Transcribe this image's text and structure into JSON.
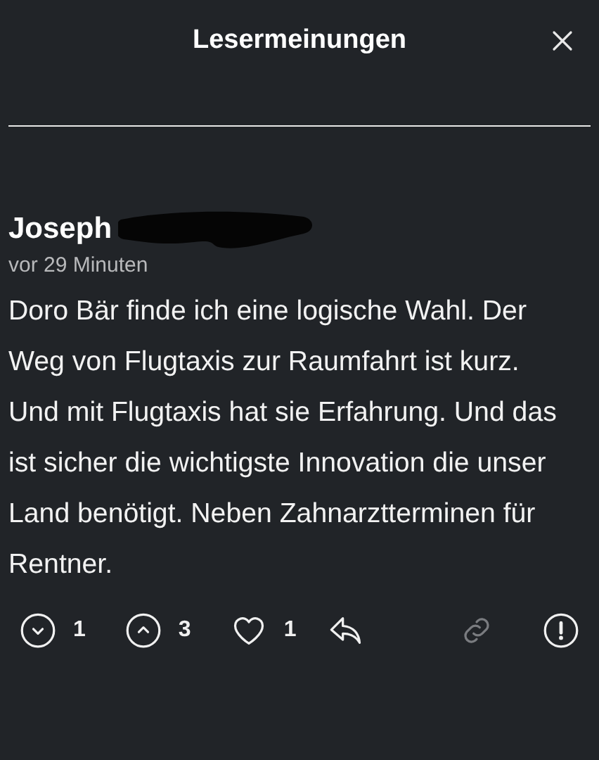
{
  "header": {
    "title": "Lesermeinungen"
  },
  "comment": {
    "author": "Joseph",
    "author_redacted": true,
    "time": "vor 29 Minuten",
    "text": "Doro Bär finde ich eine logische Wahl. Der Weg von Flugtaxis zur Raumfahrt ist kurz. Und mit Flugtaxis hat sie Erfahrung. Und das ist sicher die wichtigste Innovation die unser Land benötigt. Neben Zahnarztterminen für Rentner."
  },
  "actions": [
    {
      "kind": "downvote",
      "count": "1"
    },
    {
      "kind": "upvote",
      "count": "3"
    },
    {
      "kind": "like",
      "count": "1"
    },
    {
      "kind": "reply"
    },
    {
      "kind": "link",
      "disabled": true
    },
    {
      "kind": "report"
    }
  ]
}
